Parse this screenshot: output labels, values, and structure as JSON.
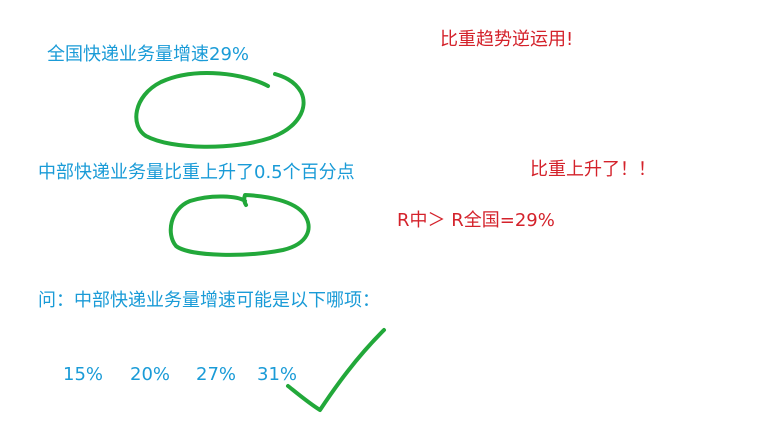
{
  "statement1": "全国快递业务量增速29%",
  "note_trend": "比重趋势逆运用!",
  "statement2": "中部快递业务量比重上升了0.5个百分点",
  "note_rise": "比重上升了！！",
  "formula": "R中＞ R全国=29%",
  "question": "问：中部快递业务量增速可能是以下哪项：",
  "options": [
    "15%",
    "20%",
    "27%",
    "31%"
  ],
  "colors": {
    "text_blue": "#1a9bd7",
    "text_red": "#d4222b",
    "ink_green": "#22a83a"
  }
}
